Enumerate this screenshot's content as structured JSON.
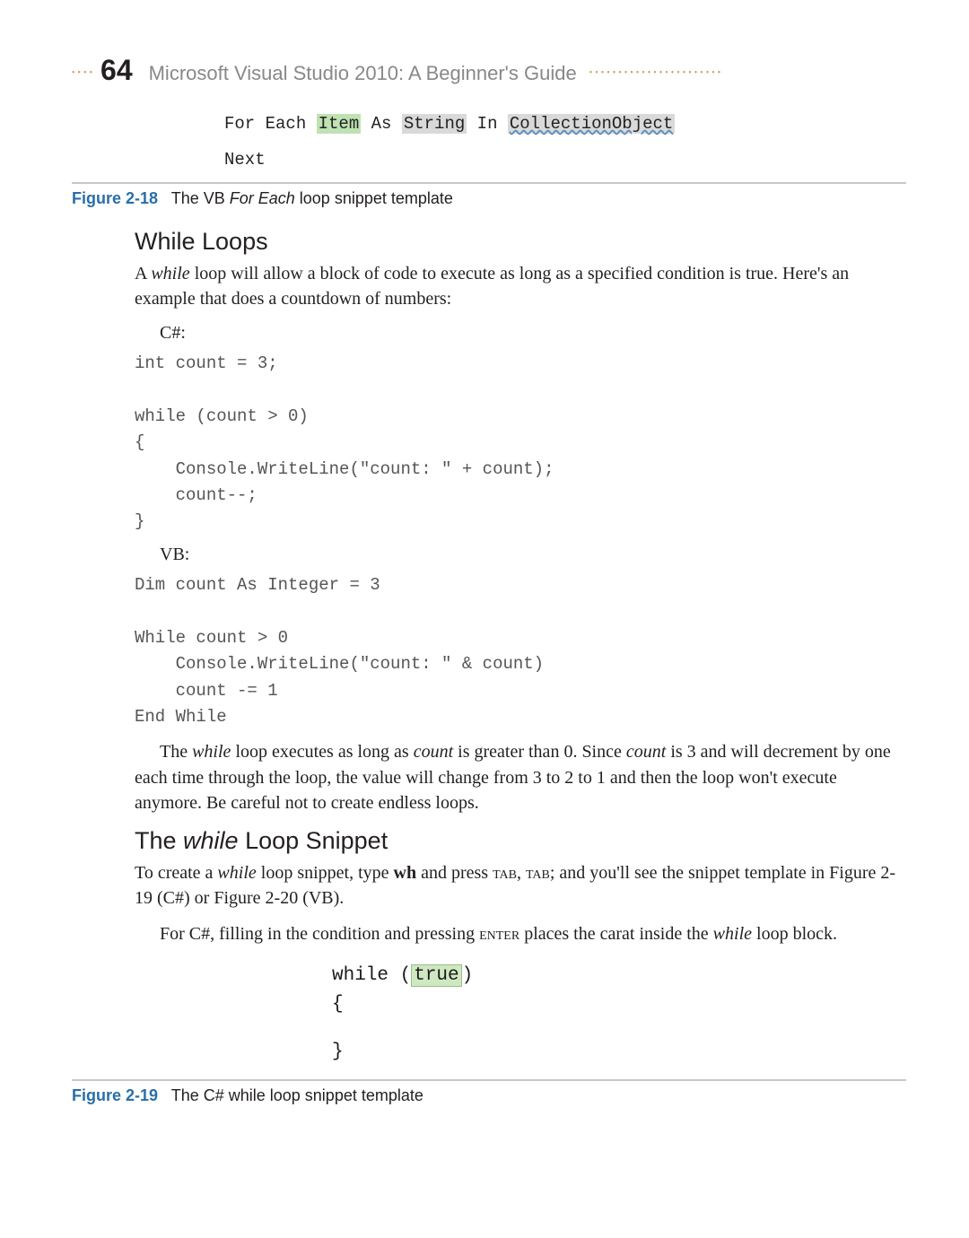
{
  "header": {
    "page_number": "64",
    "book_title": "Microsoft Visual Studio 2010: A Beginner's Guide"
  },
  "figure218": {
    "code_prefix": "For Each ",
    "code_item": "Item",
    "code_as": " As ",
    "code_type": "String",
    "code_in": " In ",
    "code_coll": "CollectionObject",
    "code_next": "Next",
    "label": "Figure 2-18",
    "caption_pre": "The VB ",
    "caption_ital": "For Each",
    "caption_post": " loop snippet template"
  },
  "while_section": {
    "heading": "While Loops",
    "para1_a": "A ",
    "para1_b": "while",
    "para1_c": " loop will allow a block of code to execute as long as a specified condition is true. Here's an example that does a countdown of numbers:",
    "cs_label": "C#:",
    "cs_code": "int count = 3;\n\nwhile (count > 0)\n{\n    Console.WriteLine(\"count: \" + count);\n    count--;\n}",
    "vb_label": "VB:",
    "vb_code": "Dim count As Integer = 3\n\nWhile count > 0\n    Console.WriteLine(\"count: \" & count)\n    count -= 1\nEnd While",
    "para2_a": "The ",
    "para2_b": "while",
    "para2_c": " loop executes as long as ",
    "para2_d": "count",
    "para2_e": " is greater than 0. Since ",
    "para2_f": "count",
    "para2_g": " is 3 and will decrement by one each time through the loop, the value will change from 3 to 2 to 1 and then the loop won't execute anymore. Be careful not to create endless loops."
  },
  "snippet_section": {
    "heading_a": "The ",
    "heading_b": "while",
    "heading_c": " Loop Snippet",
    "para1_a": "To create a ",
    "para1_b": "while",
    "para1_c": " loop snippet, type ",
    "para1_d": "wh",
    "para1_e": " and press ",
    "para1_f": "tab",
    "para1_g": ", ",
    "para1_h": "tab",
    "para1_i": "; and you'll see the snippet template in Figure 2-19 (C#) or Figure 2-20 (VB).",
    "para2_a": "For C#, filling in the condition and pressing ",
    "para2_b": "enter",
    "para2_c": " places the carat inside the ",
    "para2_d": "while",
    "para2_e": " loop block."
  },
  "figure219": {
    "line1_a": "while (",
    "line1_b": "true",
    "line1_c": ")",
    "line2": "{",
    "line3": "}",
    "label": "Figure 2-19",
    "caption": "The C# while loop snippet template"
  }
}
